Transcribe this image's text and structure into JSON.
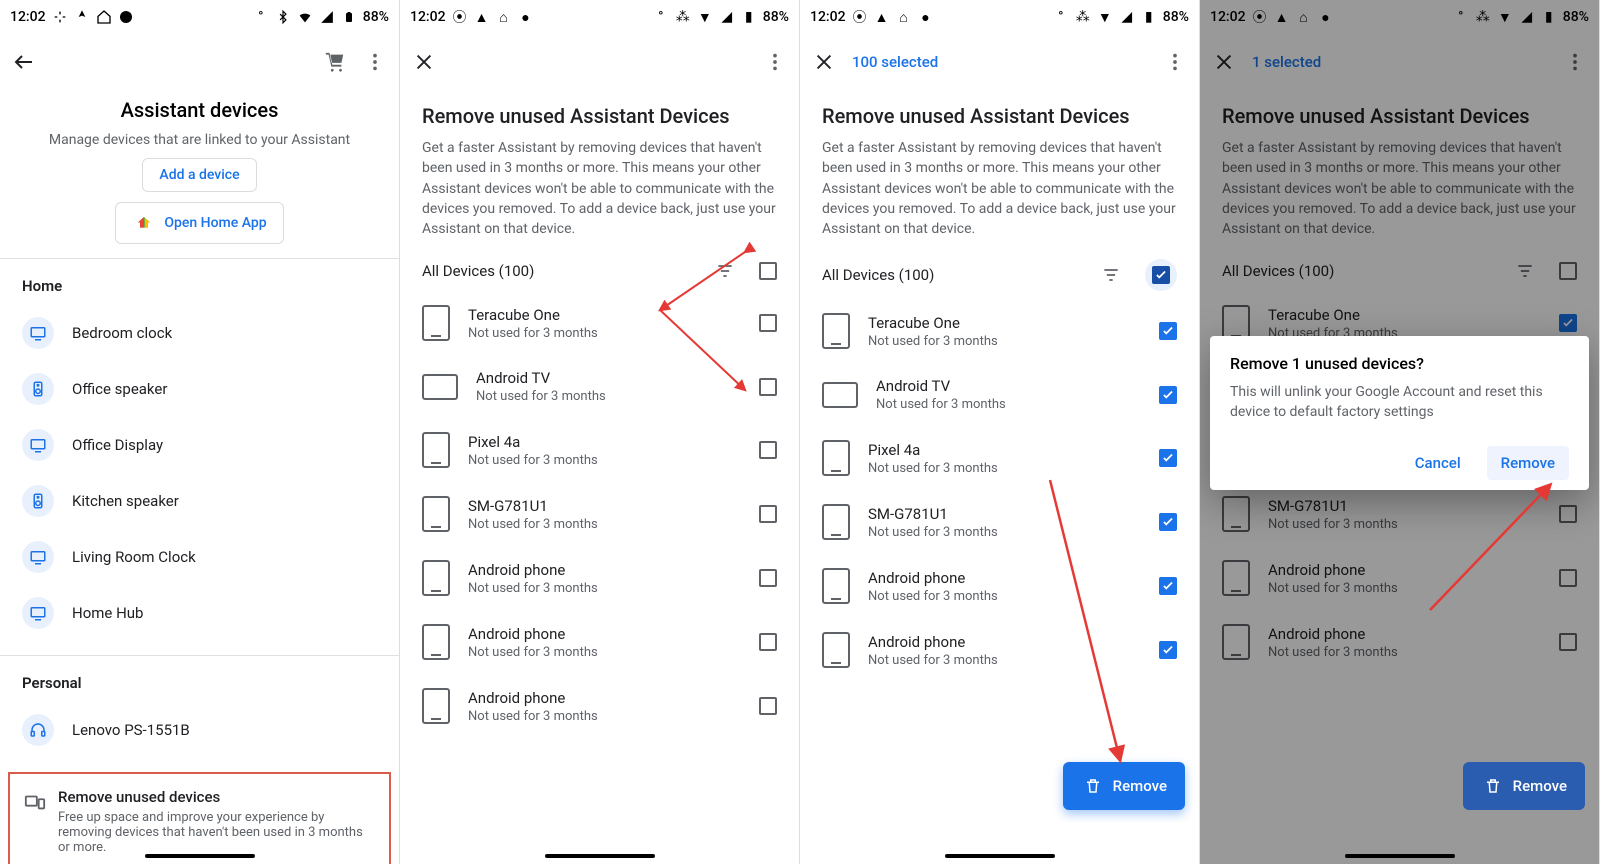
{
  "status": {
    "time": "12:02",
    "battery": "88%"
  },
  "screen1": {
    "title": "Assistant devices",
    "subtitle": "Manage devices that are linked to your Assistant",
    "addDevice": "Add a device",
    "openHome": "Open Home App",
    "homeHeader": "Home",
    "homeDevices": [
      {
        "label": "Bedroom clock",
        "icon": "clock"
      },
      {
        "label": "Office speaker",
        "icon": "speaker"
      },
      {
        "label": "Office Display",
        "icon": "display"
      },
      {
        "label": "Kitchen speaker",
        "icon": "speaker"
      },
      {
        "label": "Living Room Clock",
        "icon": "clock"
      },
      {
        "label": "Home Hub",
        "icon": "display"
      }
    ],
    "personalHeader": "Personal",
    "personalDevices": [
      {
        "label": "Lenovo PS-1551B",
        "icon": "headset"
      }
    ],
    "removeCard": {
      "title": "Remove unused devices",
      "body": "Free up space and improve your experience by removing devices that haven't been used in 3 months or more."
    }
  },
  "removePage": {
    "title": "Remove unused Assistant Devices",
    "body": "Get a faster Assistant by removing devices that haven't been used in 3 months or more. This means your other Assistant devices won't be able to communicate with the devices you removed. To add a device back, just use your Assistant on that device.",
    "allDevices": "All Devices (100)",
    "devices": [
      {
        "name": "Teracube One",
        "sub": "Not used for 3 months",
        "icon": "phone"
      },
      {
        "name": "Android TV",
        "sub": "Not used for 3 months",
        "icon": "tv"
      },
      {
        "name": "Pixel 4a",
        "sub": "Not used for 3 months",
        "icon": "phone"
      },
      {
        "name": "SM-G781U1",
        "sub": "Not used for 3 months",
        "icon": "phone"
      },
      {
        "name": "Android phone",
        "sub": "Not used for 3 months",
        "icon": "phone"
      },
      {
        "name": "Android phone",
        "sub": "Not used for 3 months",
        "icon": "phone"
      },
      {
        "name": "Android phone",
        "sub": "Not used for 3 months",
        "icon": "phone"
      }
    ]
  },
  "screen3": {
    "selected": "100  selected",
    "removeBtn": "Remove"
  },
  "screen4": {
    "selected": "1  selected",
    "dialog": {
      "title": "Remove 1 unused devices?",
      "body": "This will unlink your Google Account and reset this device to default factory settings",
      "cancel": "Cancel",
      "remove": "Remove"
    },
    "removeBtn": "Remove"
  }
}
